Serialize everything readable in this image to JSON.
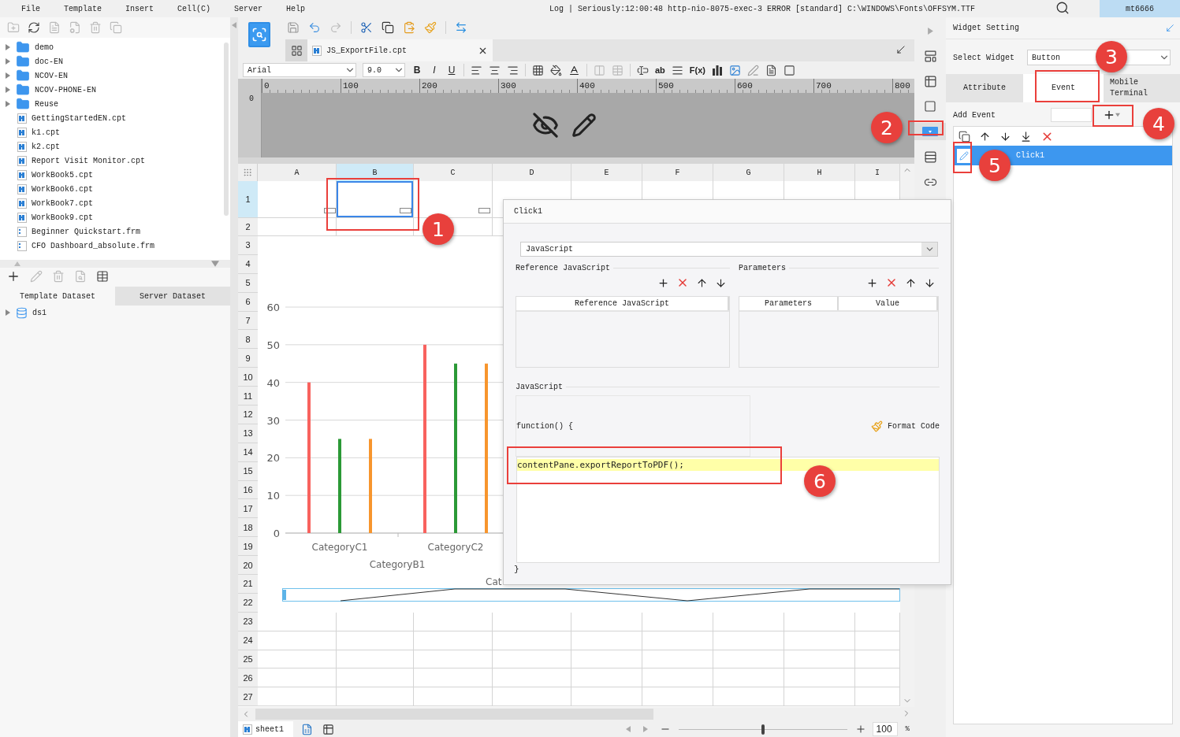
{
  "menu": {
    "items": [
      "File",
      "Template",
      "Insert",
      "Cell(C)",
      "Server",
      "Help"
    ],
    "log": "Log | Seriously:12:00:48 http-nio-8075-exec-3 ERROR [standard] C:\\WINDOWS\\Fonts\\OFFSYM.TTF",
    "user": "mt6666"
  },
  "file_tree": {
    "items": [
      {
        "kind": "folder",
        "label": "demo"
      },
      {
        "kind": "folder",
        "label": "doc-EN"
      },
      {
        "kind": "folder",
        "label": "NCOV-EN"
      },
      {
        "kind": "folder",
        "label": "NCOV-PHONE-EN"
      },
      {
        "kind": "folder",
        "label": "Reuse"
      },
      {
        "kind": "cpt",
        "label": "GettingStartedEN.cpt"
      },
      {
        "kind": "cpt",
        "label": "k1.cpt"
      },
      {
        "kind": "cpt",
        "label": "k2.cpt"
      },
      {
        "kind": "cpt",
        "label": "Report Visit Monitor.cpt"
      },
      {
        "kind": "cpt",
        "label": "WorkBook5.cpt"
      },
      {
        "kind": "cpt",
        "label": "WorkBook6.cpt"
      },
      {
        "kind": "cpt",
        "label": "WorkBook7.cpt"
      },
      {
        "kind": "cpt",
        "label": "WorkBook9.cpt"
      },
      {
        "kind": "frm",
        "label": "Beginner Quickstart.frm"
      },
      {
        "kind": "frm",
        "label": "CFO Dashboard_absolute.frm"
      }
    ]
  },
  "dataset_tabs": [
    {
      "label": "Template Dataset",
      "selected": true
    },
    {
      "label": "Server Dataset",
      "selected": false
    }
  ],
  "datasets": [
    "ds1"
  ],
  "editor_tab": {
    "label": "JS_ExportFile.cpt"
  },
  "format_bar": {
    "font": "Arial",
    "size": "9.0",
    "styles": [
      "B",
      "I",
      "U"
    ],
    "text_tool": "ab",
    "formula_tool": "F(x)"
  },
  "ruler": {
    "marks": [
      "0",
      "100",
      "200",
      "300",
      "400",
      "500",
      "600",
      "700",
      "800"
    ],
    "vertical_mark": "0"
  },
  "sheet": {
    "columns": [
      {
        "label": "A",
        "selected": false
      },
      {
        "label": "B",
        "selected": true
      },
      {
        "label": "C",
        "selected": false
      },
      {
        "label": "D",
        "selected": false
      },
      {
        "label": "E",
        "selected": false
      },
      {
        "label": "F",
        "selected": false
      },
      {
        "label": "G",
        "selected": false
      },
      {
        "label": "H",
        "selected": false
      },
      {
        "label": "I",
        "selected": false
      }
    ],
    "rows": [
      {
        "label": "1",
        "selected": true
      },
      {
        "label": "2",
        "selected": false
      },
      {
        "label": "3",
        "selected": false
      },
      {
        "label": "4",
        "selected": false
      },
      {
        "label": "5",
        "selected": false
      },
      {
        "label": "6",
        "selected": false
      },
      {
        "label": "7",
        "selected": false
      },
      {
        "label": "8",
        "selected": false
      },
      {
        "label": "9",
        "selected": false
      },
      {
        "label": "10",
        "selected": false
      },
      {
        "label": "11",
        "selected": false
      },
      {
        "label": "12",
        "selected": false
      },
      {
        "label": "13",
        "selected": false
      },
      {
        "label": "14",
        "selected": false
      },
      {
        "label": "15",
        "selected": false
      },
      {
        "label": "16",
        "selected": false
      },
      {
        "label": "17",
        "selected": false
      },
      {
        "label": "18",
        "selected": false
      },
      {
        "label": "19",
        "selected": false
      },
      {
        "label": "20",
        "selected": false
      },
      {
        "label": "21",
        "selected": false
      },
      {
        "label": "22",
        "selected": false
      },
      {
        "label": "23",
        "selected": false
      },
      {
        "label": "24",
        "selected": false
      },
      {
        "label": "25",
        "selected": false
      },
      {
        "label": "26",
        "selected": false
      },
      {
        "label": "27",
        "selected": false
      }
    ],
    "chart": {
      "chart_data": {
        "type": "bar",
        "grid": true,
        "categories": [
          "CategoryC1",
          "CategoryC2"
        ],
        "xlabel": "CategoryB1",
        "ylim": [
          0,
          60
        ],
        "yticks": [
          0,
          10,
          20,
          30,
          40,
          50,
          60
        ],
        "series": [
          {
            "color": "#f8625e",
            "values": [
              40,
              50
            ]
          },
          {
            "color": "#2b9936",
            "values": [
              25,
              45
            ]
          },
          {
            "color": "#f7952d",
            "values": [
              25,
              45
            ]
          }
        ]
      },
      "cut_label": "Cat"
    }
  },
  "sheet_tabs": [
    {
      "label": "sheet1",
      "selected": true
    }
  ],
  "zoom": {
    "value": "100",
    "unit": "%",
    "level": 0.5
  },
  "side_strip": [
    {
      "kind": "collapse",
      "selected": false
    },
    {
      "kind": "frame",
      "selected": false
    },
    {
      "kind": "cell",
      "selected": false
    },
    {
      "kind": "border",
      "selected": false
    },
    {
      "kind": "widget",
      "selected": true
    },
    {
      "kind": "layers",
      "selected": false
    },
    {
      "kind": "link",
      "selected": false
    }
  ],
  "widget_setting": {
    "title": "Widget Setting",
    "select_label": "Select Widget",
    "widget": "Button",
    "tabs": [
      {
        "label": "Attribute",
        "selected": false
      },
      {
        "label": "Event",
        "selected": true
      },
      {
        "label": "Mobile Terminal",
        "selected": false
      }
    ],
    "add_event_label": "Add Event",
    "events": [
      {
        "label": "Click1",
        "selected": true
      }
    ]
  },
  "event_dialog": {
    "title": "Click1",
    "type": "JavaScript",
    "reference_label": "Reference JavaScript",
    "reference_columns": [
      "Reference JavaScript"
    ],
    "parameters_label": "Parameters",
    "parameter_columns": [
      "Parameters",
      "Value"
    ],
    "script_label": "JavaScript",
    "function_open": "function() {",
    "format_button": "Format Code",
    "code_lines": [
      "contentPane.exportReportToPDF();"
    ],
    "function_close": "}"
  },
  "annotations": [
    {
      "number": "1"
    },
    {
      "number": "2"
    },
    {
      "number": "3"
    },
    {
      "number": "4"
    },
    {
      "number": "5"
    },
    {
      "number": "6"
    }
  ]
}
